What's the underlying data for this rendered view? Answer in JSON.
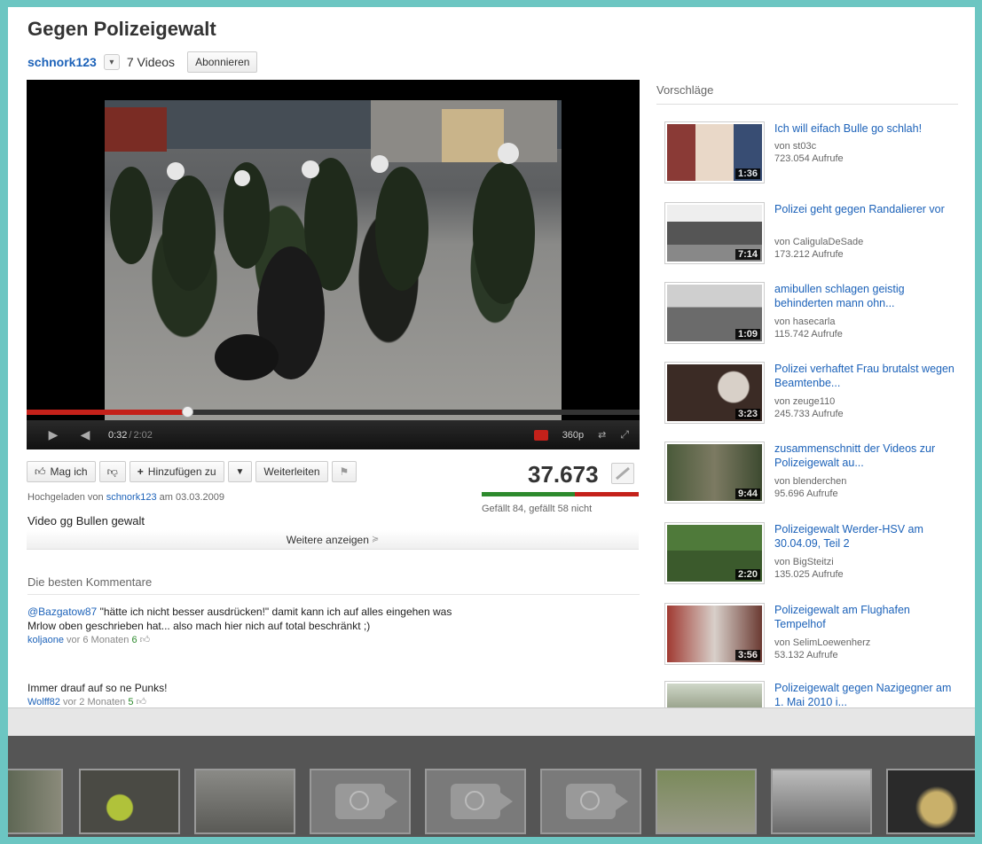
{
  "video": {
    "title": "Gegen Polizeigewalt",
    "channel": "schnork123",
    "videos_count": "7 Videos",
    "subscribe_label": "Abonnieren",
    "description": "Video gg Bullen gewalt",
    "uploaded_prefix": "Hochgeladen von",
    "uploader": "schnork123",
    "uploaded_date_text": "am 03.03.2009",
    "views": "37.673",
    "likes_text": "Gefällt 84, gefällt 58 nicht",
    "likes": 84,
    "dislikes": 58,
    "show_more": "Weitere anzeigen"
  },
  "player": {
    "current_time": "0:32",
    "separator": "/",
    "total_time": "2:02",
    "progress_fraction": 0.262,
    "quality": "360p"
  },
  "actions": {
    "like": "Mag ich",
    "add_to": "Hinzufügen zu",
    "share": "Weiterleiten"
  },
  "comments": {
    "title": "Die besten Kommentare",
    "items": [
      {
        "mention": "@Bazgatow87",
        "text": " \"hätte ich nicht besser ausdrücken!\" damit kann ich auf alles eingehen was Mrlow oben geschrieben hat... also mach hier nich auf total beschränkt ;)",
        "author": "koljaone",
        "age": "vor 6 Monaten",
        "votes": "6"
      },
      {
        "mention": "",
        "text": "Immer drauf auf so ne Punks!",
        "author": "Wolff82",
        "age": "vor 2 Monaten",
        "votes": "5"
      }
    ]
  },
  "sidebar": {
    "title": "Vorschläge",
    "items": [
      {
        "title": "Ich will eifach Bulle go schlah!",
        "by": "von st03c",
        "views": "723.054 Aufrufe",
        "duration": "1:36"
      },
      {
        "title": "Polizei geht gegen Randalierer vor",
        "by": "von CaligulaDeSade",
        "views": "173.212 Aufrufe",
        "duration": "7:14"
      },
      {
        "title": "amibullen schlagen geistig behinderten mann ohn...",
        "by": "von hasecarla",
        "views": "115.742 Aufrufe",
        "duration": "1:09"
      },
      {
        "title": "Polizei verhaftet Frau brutalst wegen Beamtenbe...",
        "by": "von zeuge110",
        "views": "245.733 Aufrufe",
        "duration": "3:23"
      },
      {
        "title": "zusammenschnitt der Videos zur Polizeigewalt au...",
        "by": "von blenderchen",
        "views": "95.696 Aufrufe",
        "duration": "9:44"
      },
      {
        "title": "Polizeigewalt Werder-HSV am 30.04.09, Teil 2",
        "by": "von BigSteitzi",
        "views": "135.025 Aufrufe",
        "duration": "2:20"
      },
      {
        "title": "Polizeigewalt am Flughafen Tempelhof",
        "by": "von SelimLoewenherz",
        "views": "53.132 Aufrufe",
        "duration": "3:56"
      },
      {
        "title": "Polizeigewalt gegen Nazigegner am 1. Mai 2010 i...",
        "by": "",
        "views": "",
        "duration": ""
      }
    ]
  }
}
